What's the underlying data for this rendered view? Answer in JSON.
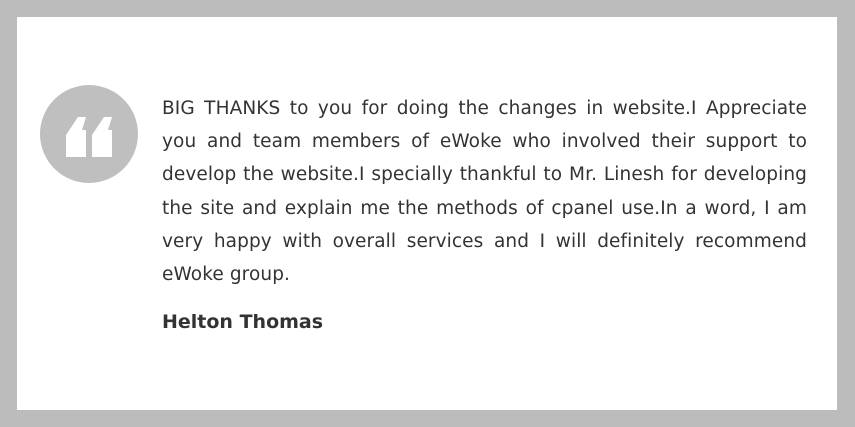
{
  "testimonial": {
    "quote": "BIG THANKS to you for doing the changes in website.I Appreciate you and team members of eWoke who involved their support to develop the website.I specially thankful to Mr. Linesh for developing the site and explain me the methods of cpanel use.In a word, I am very happy with overall services and I will definitely recommend eWoke group.",
    "author": "Helton Thomas"
  },
  "icons": {
    "quote_badge": "open-quote-icon"
  },
  "colors": {
    "background": "#bcbcbc",
    "card": "#ffffff",
    "badge": "#bfbfbf",
    "text": "#333333"
  }
}
